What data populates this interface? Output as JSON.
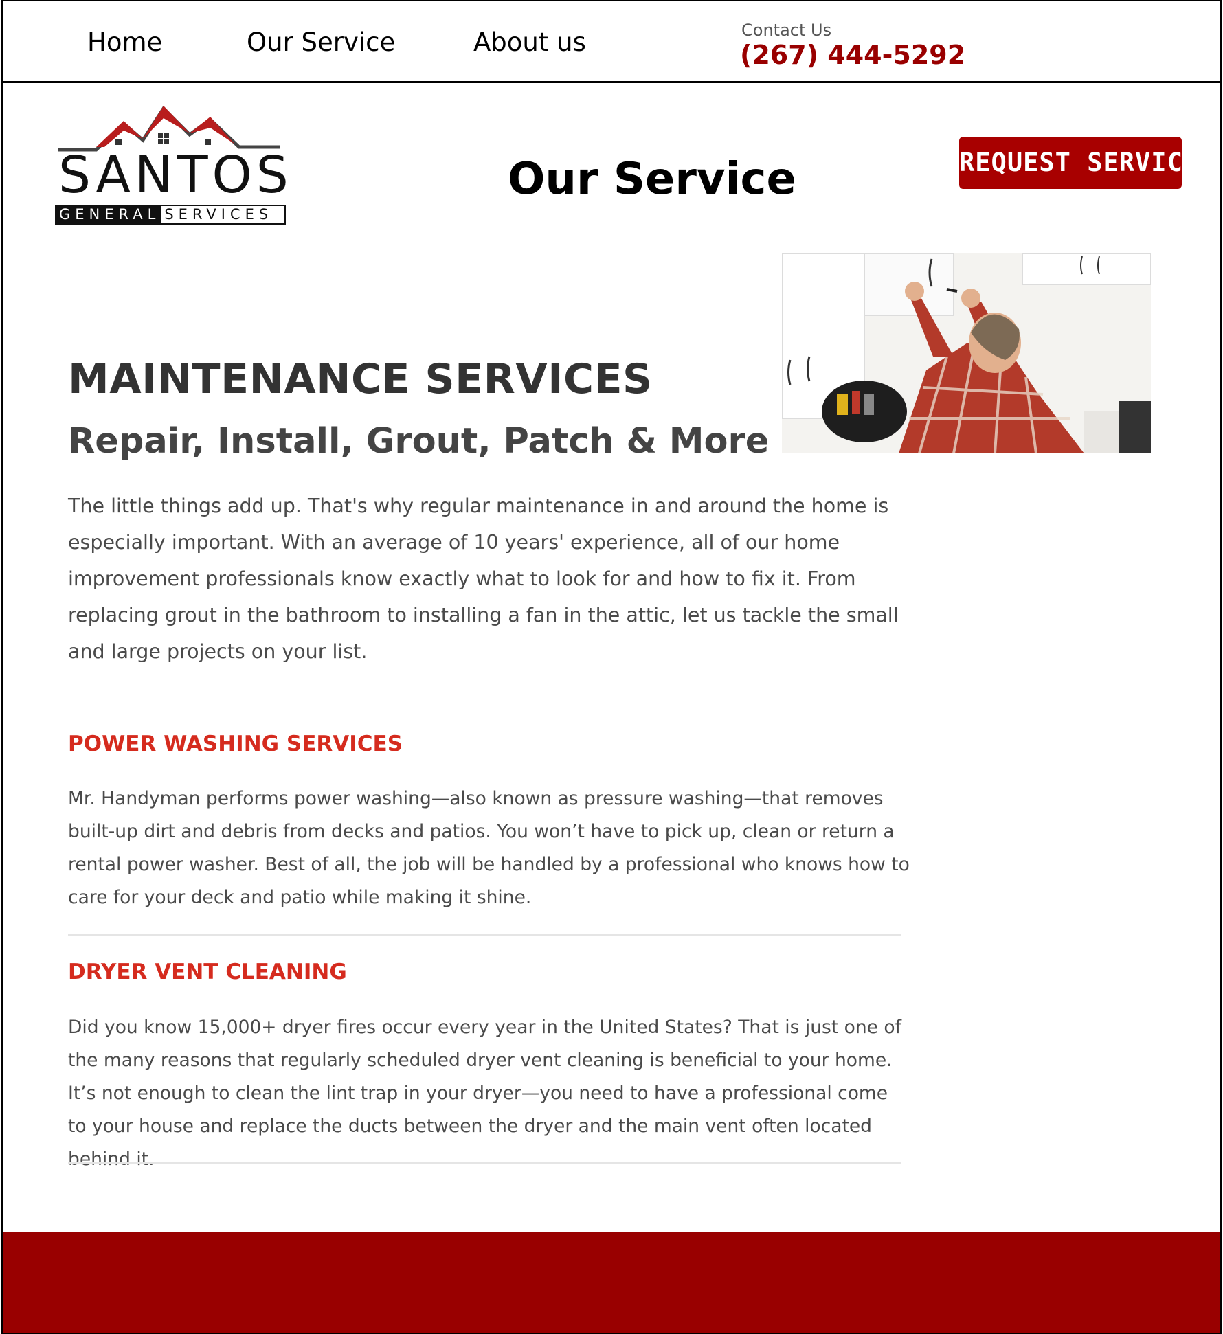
{
  "nav": {
    "home": "Home",
    "service": "Our Service",
    "about": "About us"
  },
  "contact": {
    "label": "Contact Us",
    "phone": "(267) 444-5292"
  },
  "logo": {
    "word": "SANTOS",
    "sub_a": "GENERAL",
    "sub_b": "SERVICES"
  },
  "page": {
    "heading": "Our Service",
    "request_button": "REQUEST SERVICE"
  },
  "main": {
    "title": "MAINTENANCE SERVICES",
    "subtitle": "Repair, Install, Grout, Patch & More",
    "intro": "The little things add up. That's why regular maintenance in and around the home is especially important. With an average of 10 years' experience, all of our home improvement professionals know exactly what to look for and how to fix it. From replacing grout in the bathroom to installing a fan in the attic, let us tackle the small and large projects on your list."
  },
  "sections": [
    {
      "title": "POWER WASHING SERVICES",
      "body": "Mr. Handyman performs power washing—also known as pressure washing—that removes built-up dirt and debris from decks and patios. You won’t have to pick up, clean or return a rental power washer. Best of all, the job will be handled by a professional who knows how to care for your deck and patio while making it shine."
    },
    {
      "title": "DRYER VENT CLEANING",
      "body": "Did you know 15,000+ dryer fires occur every year in the United States? That is just one of the many reasons that regularly scheduled dryer vent cleaning is beneficial to your home. It’s not enough to clean the lint trap in your dryer—you need to have a professional come to your house and replace the ducts between the dryer and the main vent often located behind it."
    }
  ],
  "colors": {
    "brand_red": "#990000",
    "button_red": "#a80000",
    "section_red": "#d52b1e"
  }
}
